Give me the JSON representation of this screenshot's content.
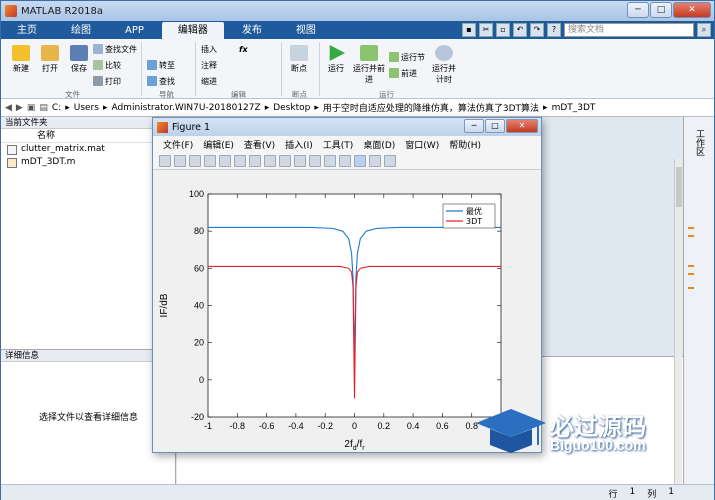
{
  "app": {
    "title": "MATLAB R2018a",
    "window_buttons": {
      "min": "─",
      "max": "□",
      "close": "✕"
    }
  },
  "tabs": [
    {
      "label": "主页"
    },
    {
      "label": "绘图"
    },
    {
      "label": "APP"
    },
    {
      "label": "编辑器",
      "active": true
    },
    {
      "label": "发布"
    },
    {
      "label": "视图"
    }
  ],
  "search": {
    "placeholder": "搜索文档"
  },
  "ribbon": {
    "new": "新建",
    "open": "打开",
    "save": "保存",
    "find_files": "查找文件",
    "compare": "比较",
    "print": "打印",
    "goto": "转至",
    "find": "查找",
    "insert": "插入",
    "comment": "注释",
    "indent": "缩进",
    "fx": "fx",
    "breakpoint": "断点",
    "run": "运行",
    "run_advance": "运行并前进",
    "run_section": "运行节",
    "advance": "前进",
    "run_time": "运行并计时",
    "groups": {
      "file": "文件",
      "navigate": "导航",
      "edit": "编辑",
      "breakpoints": "断点",
      "run": "运行"
    }
  },
  "address": {
    "path": [
      "C:",
      "Users",
      "Administrator.WIN7U-20180127Z",
      "Desktop",
      "用于空时自适应处理的降维仿真，算法仿真了3DT算法",
      "mDT_3DT"
    ],
    "path_tail": "，算法仿真了3DT算法\\mDT_3..."
  },
  "current_folder": {
    "header": "当前文件夹",
    "col_name": "名称",
    "files": [
      "clutter_matrix.mat",
      "mDT_3DT.m"
    ]
  },
  "details": {
    "header": "详细信息",
    "message": "选择文件以查看详细信息"
  },
  "workspace_label": "工作区",
  "status": {
    "row_label": "行",
    "row": "1",
    "col_label": "列",
    "col": "1"
  },
  "figure": {
    "title": "Figure 1",
    "menu": [
      "文件(F)",
      "编辑(E)",
      "查看(V)",
      "插入(I)",
      "工具(T)",
      "桌面(D)",
      "窗口(W)",
      "帮助(H)"
    ]
  },
  "chart_data": {
    "type": "line",
    "title": "",
    "xlabel": "2f_d/f_r",
    "ylabel": "IF/dB",
    "xlim": [
      -1,
      1
    ],
    "ylim": [
      -20,
      100
    ],
    "xticks": [
      -1,
      -0.8,
      -0.6,
      -0.4,
      -0.2,
      0,
      0.2,
      0.4,
      0.6,
      0.8,
      1
    ],
    "yticks": [
      -20,
      0,
      20,
      40,
      60,
      80,
      100
    ],
    "legend_position": "top-right",
    "series": [
      {
        "name": "最优",
        "color": "#1f77d4",
        "x": [
          -1,
          -0.6,
          -0.3,
          -0.15,
          -0.08,
          -0.04,
          -0.02,
          -0.01,
          0,
          0.01,
          0.02,
          0.04,
          0.08,
          0.15,
          0.3,
          0.6,
          1
        ],
        "y": [
          82,
          82,
          82,
          81.5,
          80,
          76,
          68,
          55,
          10,
          55,
          68,
          76,
          80,
          81.5,
          82,
          82,
          82
        ]
      },
      {
        "name": "3DT",
        "color": "#e8202a",
        "x": [
          -1,
          -0.6,
          -0.3,
          -0.1,
          -0.04,
          -0.02,
          -0.01,
          0,
          0.01,
          0.02,
          0.04,
          0.1,
          0.3,
          0.6,
          1
        ],
        "y": [
          61,
          61,
          61,
          61,
          60,
          58,
          50,
          -10,
          50,
          58,
          60,
          61,
          61,
          61,
          61
        ]
      }
    ]
  },
  "watermark": {
    "brand": "必过源码",
    "url": "Biguo100.com"
  }
}
